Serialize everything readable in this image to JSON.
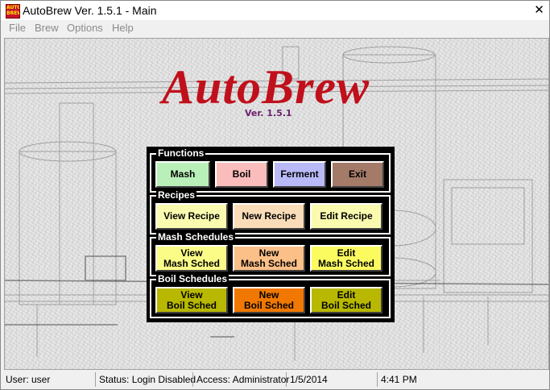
{
  "titlebar": {
    "title": "AutoBrew Ver. 1.5.1 - Main",
    "app_icon_text": "AUTO BREW",
    "close_glyph": "✕"
  },
  "menu": [
    "File",
    "Brew",
    "Options",
    "Help"
  ],
  "header": {
    "logo": "AutoBrew",
    "version": "Ver. 1.5.1"
  },
  "functions": {
    "label": "Functions",
    "buttons": [
      {
        "label": "Mash",
        "color": "#b9f0b9"
      },
      {
        "label": "Boil",
        "color": "#fbbcbc"
      },
      {
        "label": "Ferment",
        "color": "#b9b9f8"
      },
      {
        "label": "Exit",
        "color": "#a47a68"
      }
    ]
  },
  "recipes": {
    "label": "Recipes",
    "buttons": [
      {
        "label": "View Recipe",
        "color": "#fbfbb0"
      },
      {
        "label": "New Recipe",
        "color": "#fbdcb8"
      },
      {
        "label": "Edit Recipe",
        "color": "#fbfbb0"
      }
    ]
  },
  "mash_schedules": {
    "label": "Mash Schedules",
    "buttons": [
      {
        "line1": "View",
        "line2": "Mash Sched",
        "color": "#fbfb88"
      },
      {
        "line1": "New",
        "line2": "Mash Sched",
        "color": "#fbbf88"
      },
      {
        "line1": "Edit",
        "line2": "Mash Sched",
        "color": "#fbfb60"
      }
    ]
  },
  "boil_schedules": {
    "label": "Boil Schedules",
    "buttons": [
      {
        "line1": "View",
        "line2": "Boil Sched",
        "color": "#b8b800"
      },
      {
        "line1": "New",
        "line2": "Boil Sched",
        "color": "#f07800"
      },
      {
        "line1": "Edit",
        "line2": "Boil Sched",
        "color": "#b8b800"
      }
    ]
  },
  "status": {
    "user": "User: user",
    "status": "Status: Login Disabled",
    "access": "Access: Administrator",
    "date": "1/5/2014",
    "time": "4:41 PM"
  }
}
